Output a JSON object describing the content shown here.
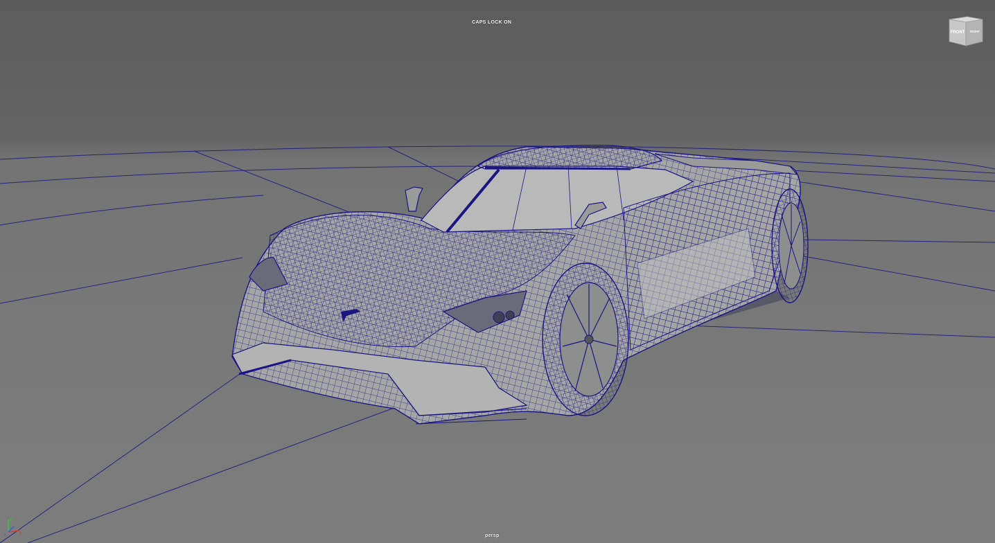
{
  "viewport": {
    "status_text": "CAPS LOCK ON",
    "camera_name": "persp",
    "background_top": "#5c5c5c",
    "background_bottom": "#7d7d7d",
    "wireframe_color": "#1a1580"
  },
  "view_cube": {
    "front_label": "FRONT",
    "right_label": "RIGHT"
  },
  "axis_gizmo": {
    "x_label": "x",
    "y_label": "y",
    "z_label": "z",
    "x_color": "#d23a3a",
    "y_color": "#3ec43e",
    "z_color": "#3a5ee0"
  },
  "scene": {
    "object": "sports-car-wireframe-model",
    "grid_visible": true
  }
}
